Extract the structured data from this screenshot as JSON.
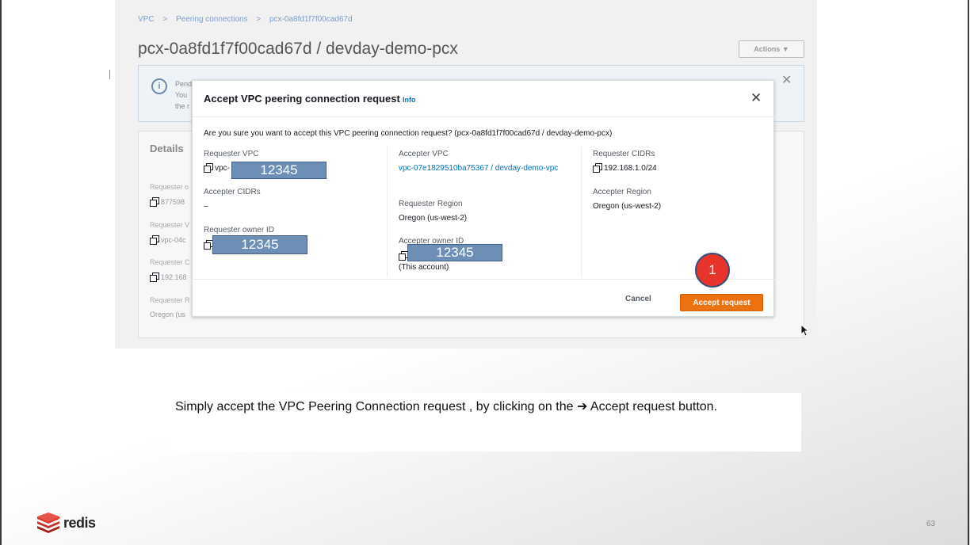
{
  "background_page": {
    "breadcrumb": [
      "VPC",
      ">",
      "Peering connections",
      ">",
      "pcx-0a8fd1f7f00cad67d"
    ],
    "title": "pcx-0a8fd1f7f00cad67d / devday-demo-pcx",
    "actions_label": "Actions ▼",
    "alert_lines": [
      "Pending acceptance",
      "You",
      "the r"
    ],
    "details_title": "Details",
    "details_fragments": [
      "Requester o",
      "877598",
      "Requester V",
      "vpc-04c",
      "Requester C",
      "192.168",
      "Requester R",
      "Oregon (us"
    ]
  },
  "modal": {
    "title": "Accept VPC peering connection request",
    "info_link": "Info",
    "question": "Are you sure you want to accept this VPC peering connection request? (pcx-0a8fd1f7f00cad67d / devday-demo-pcx)",
    "requester_vpc": {
      "label": "Requester VPC",
      "value_prefix": "vpc-",
      "redacted": "12345"
    },
    "accepter_cidrs": {
      "label": "Accepter CIDRs",
      "value": "–"
    },
    "requester_owner_id": {
      "label": "Requester owner ID",
      "redacted": "12345"
    },
    "accepter_vpc": {
      "label": "Accepter VPC",
      "value": "vpc-07e1829510ba75367 / devday-demo-vpc"
    },
    "requester_region": {
      "label": "Requester Region",
      "value": "Oregon (us-west-2)"
    },
    "accepter_owner_id": {
      "label": "Accepter owner ID",
      "redacted": "12345",
      "note": "(This account)"
    },
    "requester_cidrs": {
      "label": "Requester CIDRs",
      "value": "192.168.1.0/24"
    },
    "accepter_region": {
      "label": "Accepter Region",
      "value": "Oregon (us-west-2)"
    },
    "cancel_label": "Cancel",
    "accept_label": "Accept request"
  },
  "step_badge": "1",
  "caption": "Simply accept the VPC Peering Connection request , by clicking on the ➔ Accept request button.",
  "footer": {
    "logo_text": "redis",
    "page_number": "63"
  },
  "colors": {
    "accent_orange": "#ec7211",
    "link_blue": "#0073bb",
    "badge_red": "#e8352b",
    "redaction_blue": "#6d8fb5"
  }
}
